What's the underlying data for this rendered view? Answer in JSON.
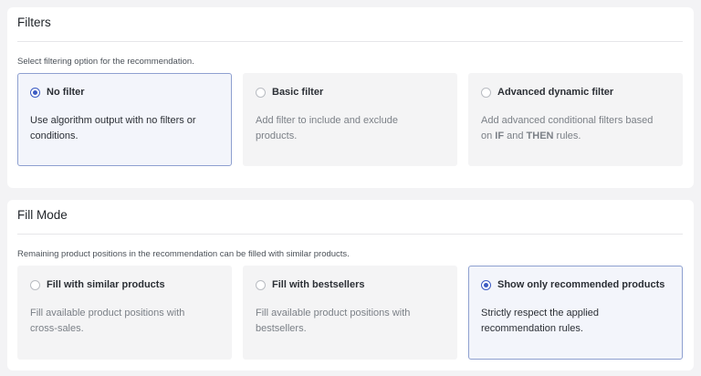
{
  "filters": {
    "title": "Filters",
    "description": "Select filtering option for the recommendation.",
    "options": [
      {
        "label": "No filter",
        "text": "Use algorithm output with no filters or conditions.",
        "selected": true
      },
      {
        "label": "Basic filter",
        "text": "Add filter to include and exclude products.",
        "selected": false
      },
      {
        "label": "Advanced dynamic filter",
        "text_parts": [
          "Add advanced conditional filters based on ",
          "IF",
          " and ",
          "THEN",
          " rules."
        ],
        "selected": false
      }
    ]
  },
  "fill_mode": {
    "title": "Fill Mode",
    "description": "Remaining product positions in the recommendation can be filled with similar products.",
    "options": [
      {
        "label": "Fill with similar products",
        "text": "Fill available product positions with cross-sales.",
        "selected": false
      },
      {
        "label": "Fill with bestsellers",
        "text": "Fill available product positions with bestsellers.",
        "selected": false
      },
      {
        "label": "Show only recommended products",
        "text": "Strictly respect the applied recommendation rules.",
        "selected": true
      }
    ]
  },
  "colors": {
    "accent": "#3c5bc3",
    "selected_border": "#8ea0d0",
    "card_bg": "#f4f4f5"
  }
}
